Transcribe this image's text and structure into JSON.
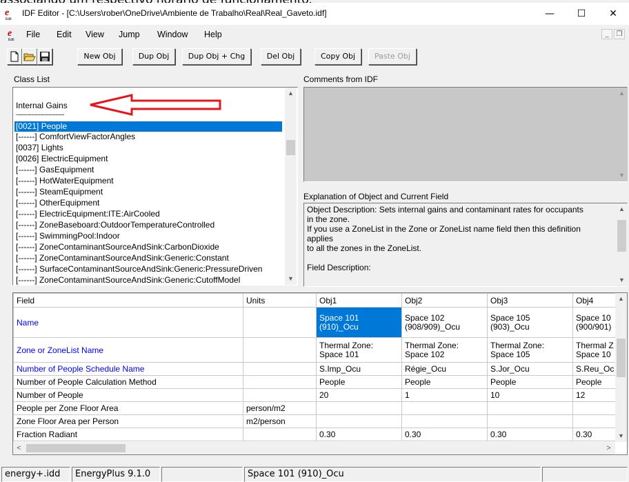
{
  "caption_text": "associando um respectivo horário de funcionamento.",
  "window": {
    "title": "IDF Editor - [C:\\Users\\rober\\OneDrive\\Ambiente de Trabalho\\Real\\Real_Gaveto.idf]",
    "minimize_glyph": "—",
    "maximize_glyph": "☐",
    "close_glyph": "✕"
  },
  "menu": {
    "items": [
      "File",
      "Edit",
      "View",
      "Jump",
      "Window",
      "Help"
    ],
    "mdi_min": "_",
    "mdi_restore": "❐"
  },
  "toolbar": {
    "new_obj": "New Obj",
    "dup_obj": "Dup Obj",
    "dup_obj_chg": "Dup Obj + Chg",
    "del_obj": "Del Obj",
    "copy_obj": "Copy Obj",
    "paste_obj": "Paste Obj"
  },
  "class_list": {
    "label": "Class List",
    "group_title": "Internal Gains",
    "separator": "----------------------------",
    "items": [
      "[0021]  People",
      "[------]  ComfortViewFactorAngles",
      "[0037]  Lights",
      "[0026]  ElectricEquipment",
      "[------]  GasEquipment",
      "[------]  HotWaterEquipment",
      "[------]  SteamEquipment",
      "[------]  OtherEquipment",
      "[------]  ElectricEquipment:ITE:AirCooled",
      "[------]  ZoneBaseboard:OutdoorTemperatureControlled",
      "[------]  SwimmingPool:Indoor",
      "[------]  ZoneContaminantSourceAndSink:CarbonDioxide",
      "[------]  ZoneContaminantSourceAndSink:Generic:Constant",
      "[------]  SurfaceContaminantSourceAndSink:Generic:PressureDriven",
      "[------]  ZoneContaminantSourceAndSink:Generic:CutoffModel"
    ]
  },
  "comments": {
    "label": "Comments from IDF"
  },
  "explanation": {
    "label": "Explanation of Object and Current Field",
    "lines": [
      "Object Description: Sets internal gains and contaminant rates for occupants",
      "in the zone.",
      "If you use a ZoneList in the Zone or ZoneList name field then this definition",
      "applies",
      "to all the zones in the ZoneList.",
      "",
      "Field Description:"
    ]
  },
  "grid": {
    "headers": [
      "Field",
      "Units",
      "Obj1",
      "Obj2",
      "Obj3",
      "Obj4"
    ],
    "rows": [
      {
        "field": "Name",
        "units": "",
        "values": [
          "Space 101 (910)_Ocu",
          "Space 102 (908/909)_Ocu",
          "Space 105 (903)_Ocu",
          "Space 10 (900/901)"
        ]
      },
      {
        "field": "Zone or ZoneList Name",
        "units": "",
        "values": [
          "Thermal Zone: Space 101",
          "Thermal Zone: Space 102",
          "Thermal Zone: Space 105",
          "Thermal Z Space 10"
        ]
      },
      {
        "field": "Number of People Schedule Name",
        "units": "",
        "values": [
          "S.Imp_Ocu",
          "Régie_Ocu",
          "S.Jor_Ocu",
          "S.Reu_Oc"
        ]
      },
      {
        "field": "Number of People Calculation Method",
        "units": "",
        "values": [
          "People",
          "People",
          "People",
          "People"
        ]
      },
      {
        "field": "Number of People",
        "units": "",
        "values": [
          "20",
          "1",
          "10",
          "12"
        ]
      },
      {
        "field": "People per Zone Floor Area",
        "units": "person/m2",
        "values": [
          "",
          "",
          "",
          ""
        ]
      },
      {
        "field": "Zone Floor Area per Person",
        "units": "m2/person",
        "values": [
          "",
          "",
          "",
          ""
        ]
      },
      {
        "field": "Fraction Radiant",
        "units": "",
        "values": [
          "0.30",
          "0.30",
          "0.30",
          "0.30"
        ]
      }
    ]
  },
  "status": {
    "pane1": "energy+.idd",
    "pane2": "EnergyPlus 9.1.0",
    "pane3": "",
    "pane4": "Space 101 (910)_Ocu",
    "pane5": ""
  },
  "colors": {
    "selection": "#0078d7",
    "arrow": "#e8141c",
    "field_link": "#0000ff"
  }
}
